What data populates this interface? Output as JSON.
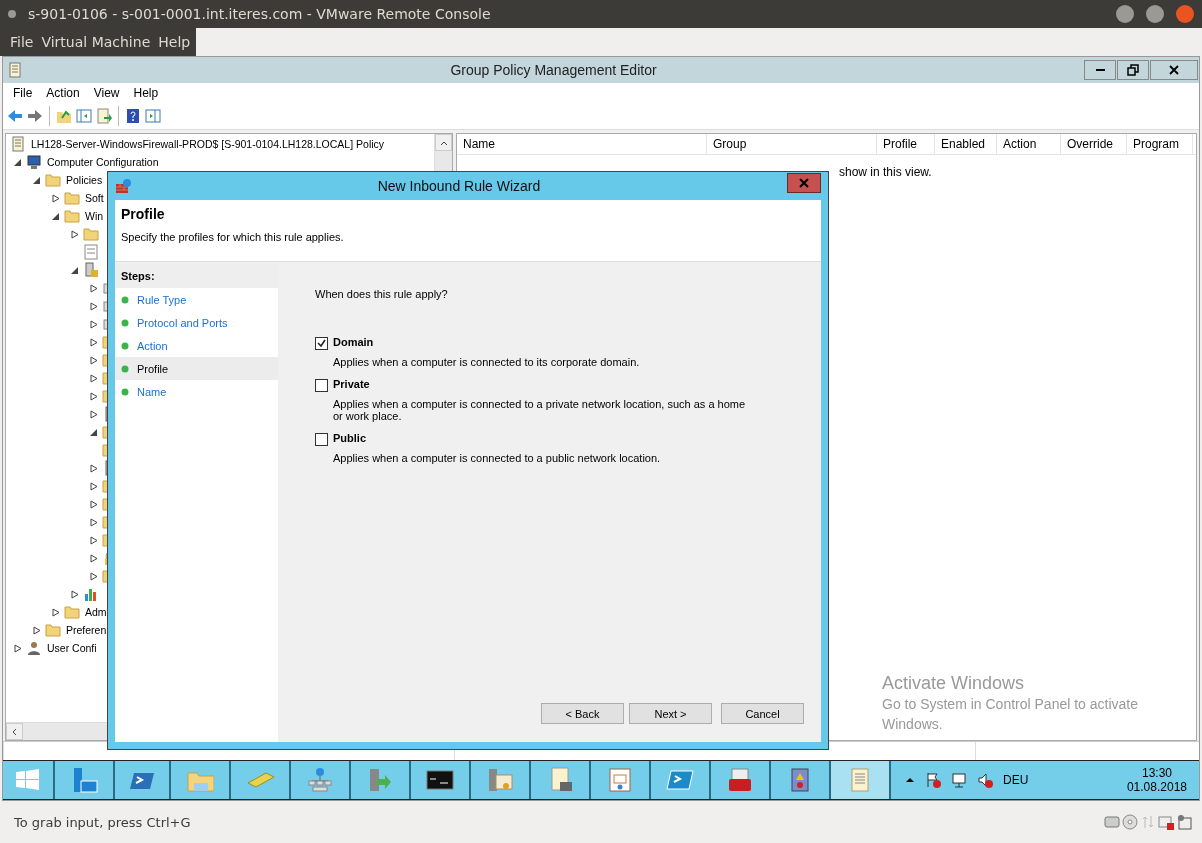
{
  "vm_window": {
    "title": "s-901-0106 - s-001-0001.int.iteres.com - VMware Remote Console",
    "menu": [
      "File",
      "Virtual Machine",
      "Help"
    ],
    "status_text": "To grab input, press Ctrl+G"
  },
  "editor": {
    "title": "Group Policy Management Editor",
    "menu": [
      "File",
      "Action",
      "View",
      "Help"
    ],
    "tree": [
      {
        "kind": "policy",
        "label": "LH128-Server-WindowsFirewall-PROD$ [S-901-0104.LH128.LOCAL] Policy",
        "children": [
          {
            "kind": "computer",
            "label": "Computer Configuration",
            "expanded": true,
            "children": [
              {
                "kind": "folder",
                "label": "Policies",
                "expanded": true,
                "children": [
                  {
                    "kind": "folder",
                    "label": "Soft",
                    "expanded": false
                  },
                  {
                    "kind": "folder",
                    "label": "Win",
                    "expanded": true,
                    "children": [
                      {
                        "kind": "folder",
                        "expanded": false
                      },
                      {
                        "kind": "script"
                      },
                      {
                        "kind": "security",
                        "expanded": true,
                        "children": [
                          {
                            "kind": "device",
                            "expanded": false
                          },
                          {
                            "kind": "device",
                            "expanded": false
                          },
                          {
                            "kind": "device",
                            "expanded": false
                          },
                          {
                            "kind": "folder",
                            "expanded": false
                          },
                          {
                            "kind": "folder",
                            "expanded": false
                          },
                          {
                            "kind": "folder",
                            "expanded": false
                          },
                          {
                            "kind": "folder",
                            "expanded": false
                          },
                          {
                            "kind": "server",
                            "expanded": false
                          },
                          {
                            "kind": "folder",
                            "expanded": true
                          },
                          {
                            "kind": "folder"
                          },
                          {
                            "kind": "server",
                            "expanded": false
                          },
                          {
                            "kind": "folder",
                            "expanded": false
                          },
                          {
                            "kind": "folder",
                            "expanded": false
                          },
                          {
                            "kind": "folder",
                            "expanded": false
                          },
                          {
                            "kind": "folder",
                            "expanded": false
                          },
                          {
                            "kind": "lock",
                            "expanded": false
                          },
                          {
                            "kind": "folder",
                            "expanded": false
                          }
                        ]
                      },
                      {
                        "kind": "chart",
                        "expanded": false
                      }
                    ]
                  },
                  {
                    "kind": "folder",
                    "label": "Adm",
                    "expanded": false
                  }
                ]
              },
              {
                "kind": "folder",
                "label": "Preferen",
                "expanded": false
              }
            ]
          },
          {
            "kind": "user",
            "label": "User Confi",
            "expanded": false
          }
        ]
      }
    ],
    "columns": [
      "Name",
      "Group",
      "Profile",
      "Enabled",
      "Action",
      "Override",
      "Program"
    ],
    "empty_message": "show in this view.",
    "activation": {
      "title": "Activate Windows",
      "text": "Go to System in Control Panel to activate Windows."
    }
  },
  "wizard": {
    "title": "New Inbound Rule Wizard",
    "heading": "Profile",
    "subtitle": "Specify the profiles for which this rule applies.",
    "steps_title": "Steps:",
    "steps": [
      {
        "label": "Rule Type",
        "selected": false
      },
      {
        "label": "Protocol and Ports",
        "selected": false
      },
      {
        "label": "Action",
        "selected": false
      },
      {
        "label": "Profile",
        "selected": true
      },
      {
        "label": "Name",
        "selected": false
      }
    ],
    "question": "When does this rule apply?",
    "options": [
      {
        "label": "Domain",
        "description": "Applies when a computer is connected to its corporate domain.",
        "checked": true
      },
      {
        "label": "Private",
        "description": "Applies when a computer is connected to a private network location, such as a home or work place.",
        "checked": false
      },
      {
        "label": "Public",
        "description": "Applies when a computer is connected to a public network location.",
        "checked": false
      }
    ],
    "buttons": [
      "< Back",
      "Next >",
      "Cancel"
    ]
  },
  "taskbar": {
    "buttons": [
      {
        "selected": false
      },
      {
        "selected": false
      },
      {
        "selected": false
      },
      {
        "selected": false
      },
      {
        "selected": false
      },
      {
        "selected": false
      },
      {
        "selected": false
      },
      {
        "selected": false
      },
      {
        "selected": false
      },
      {
        "selected": false
      },
      {
        "selected": false
      },
      {
        "selected": false
      },
      {
        "selected": false
      },
      {
        "selected": false
      },
      {
        "selected": true
      }
    ],
    "language": "DEU",
    "time": "13:30",
    "date": "01.08.2018"
  }
}
